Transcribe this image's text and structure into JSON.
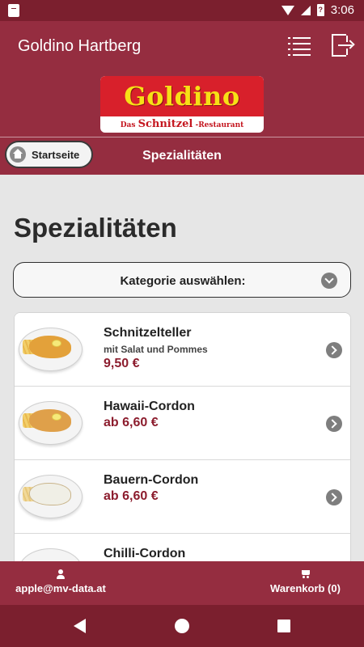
{
  "status": {
    "time": "3:06"
  },
  "app": {
    "title": "Goldino Hartberg",
    "logo_name": "Goldino",
    "logo_tagline_prefix": "Das",
    "logo_tagline_main": "Schnitzel",
    "logo_tagline_suffix": "-Restaurant"
  },
  "nav": {
    "home_label": "Startseite",
    "title": "Spezialitäten"
  },
  "page": {
    "title": "Spezialitäten",
    "category_select": "Kategorie auswählen:"
  },
  "items": [
    {
      "title": "Schnitzelteller",
      "subtitle": "mit Salat und Pommes",
      "price": "9,50 €"
    },
    {
      "title": "Hawaii-Cordon",
      "subtitle": "",
      "price": "ab 6,60 €"
    },
    {
      "title": "Bauern-Cordon",
      "subtitle": "",
      "price": "ab 6,60 €"
    },
    {
      "title": "Chilli-Cordon",
      "subtitle": "",
      "price": ""
    }
  ],
  "bottom": {
    "user": "apple@mv-data.at",
    "cart": "Warenkorb (0)"
  },
  "colors": {
    "primary": "#952d40",
    "status_bar": "#7b1f2e",
    "price": "#8c1d2e",
    "logo_red": "#d8202b",
    "logo_yellow": "#f7e016"
  },
  "icons": [
    "sim-card-icon",
    "wifi-icon",
    "signal-icon",
    "battery-icon",
    "list-icon",
    "logout-icon",
    "home-icon",
    "chevron-down-icon",
    "chevron-right-icon",
    "user-icon",
    "cart-icon",
    "back-icon",
    "home-circle-icon",
    "recents-icon"
  ]
}
